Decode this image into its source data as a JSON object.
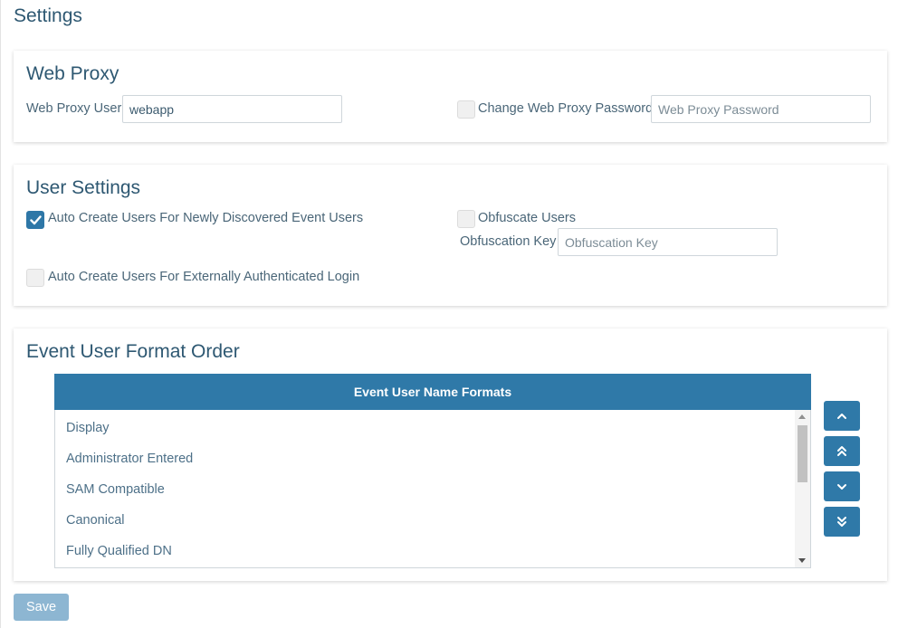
{
  "page": {
    "title": "Settings"
  },
  "web_proxy": {
    "title": "Web Proxy",
    "user_label": "Web Proxy User",
    "user_value": "webapp",
    "change_password_label": "Change Web Proxy Password",
    "change_password_checked": false,
    "password_placeholder": "Web Proxy Password"
  },
  "user_settings": {
    "title": "User Settings",
    "auto_create_event_label": "Auto Create Users For Newly Discovered Event Users",
    "auto_create_event_checked": true,
    "obfuscate_label": "Obfuscate Users",
    "obfuscate_checked": false,
    "obfuscation_key_label": "Obfuscation Key",
    "obfuscation_key_placeholder": "Obfuscation Key",
    "auto_create_external_label": "Auto Create Users For Externally Authenticated Login",
    "auto_create_external_checked": false
  },
  "format_order": {
    "title": "Event User Format Order",
    "list_header": "Event User Name Formats",
    "items": [
      "Display",
      "Administrator Entered",
      "SAM Compatible",
      "Canonical",
      "Fully Qualified DN"
    ],
    "buttons": [
      "chevron-up-icon",
      "double-chevron-up-icon",
      "chevron-down-icon",
      "double-chevron-down-icon"
    ]
  },
  "actions": {
    "save_label": "Save"
  },
  "colors": {
    "accent": "#2f79a8",
    "title": "#2e5872",
    "save_disabled": "#8db6d2"
  }
}
